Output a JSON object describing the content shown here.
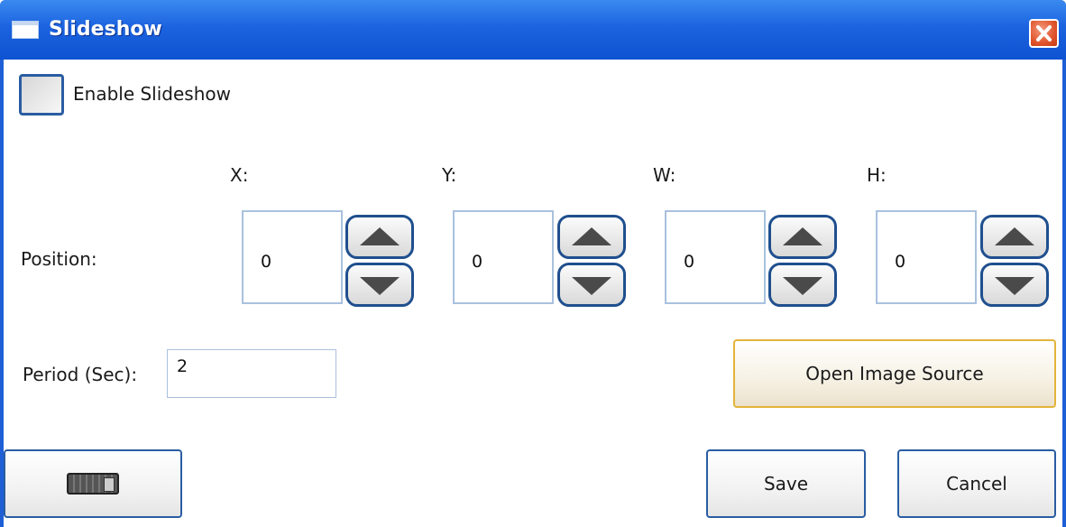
{
  "window": {
    "title": "Slideshow",
    "close_icon": "close-icon",
    "title_icon": "window-icon"
  },
  "enable": {
    "label": "Enable Slideshow",
    "checked": false
  },
  "axes": [
    {
      "label": "X:",
      "value": "0"
    },
    {
      "label": "Y:",
      "value": "0"
    },
    {
      "label": "W:",
      "value": "0"
    },
    {
      "label": "H:",
      "value": "0"
    }
  ],
  "position_label": "Position:",
  "period": {
    "label": "Period (Sec):",
    "value": "2"
  },
  "buttons": {
    "open_image_source": "Open Image Source",
    "save": "Save",
    "cancel": "Cancel",
    "keyboard_icon": "keyboard-icon"
  },
  "colors": {
    "titlebar": "#1c63e0",
    "border": "#2a5da2",
    "focus": "#e3b43a",
    "close": "#e0542c"
  }
}
